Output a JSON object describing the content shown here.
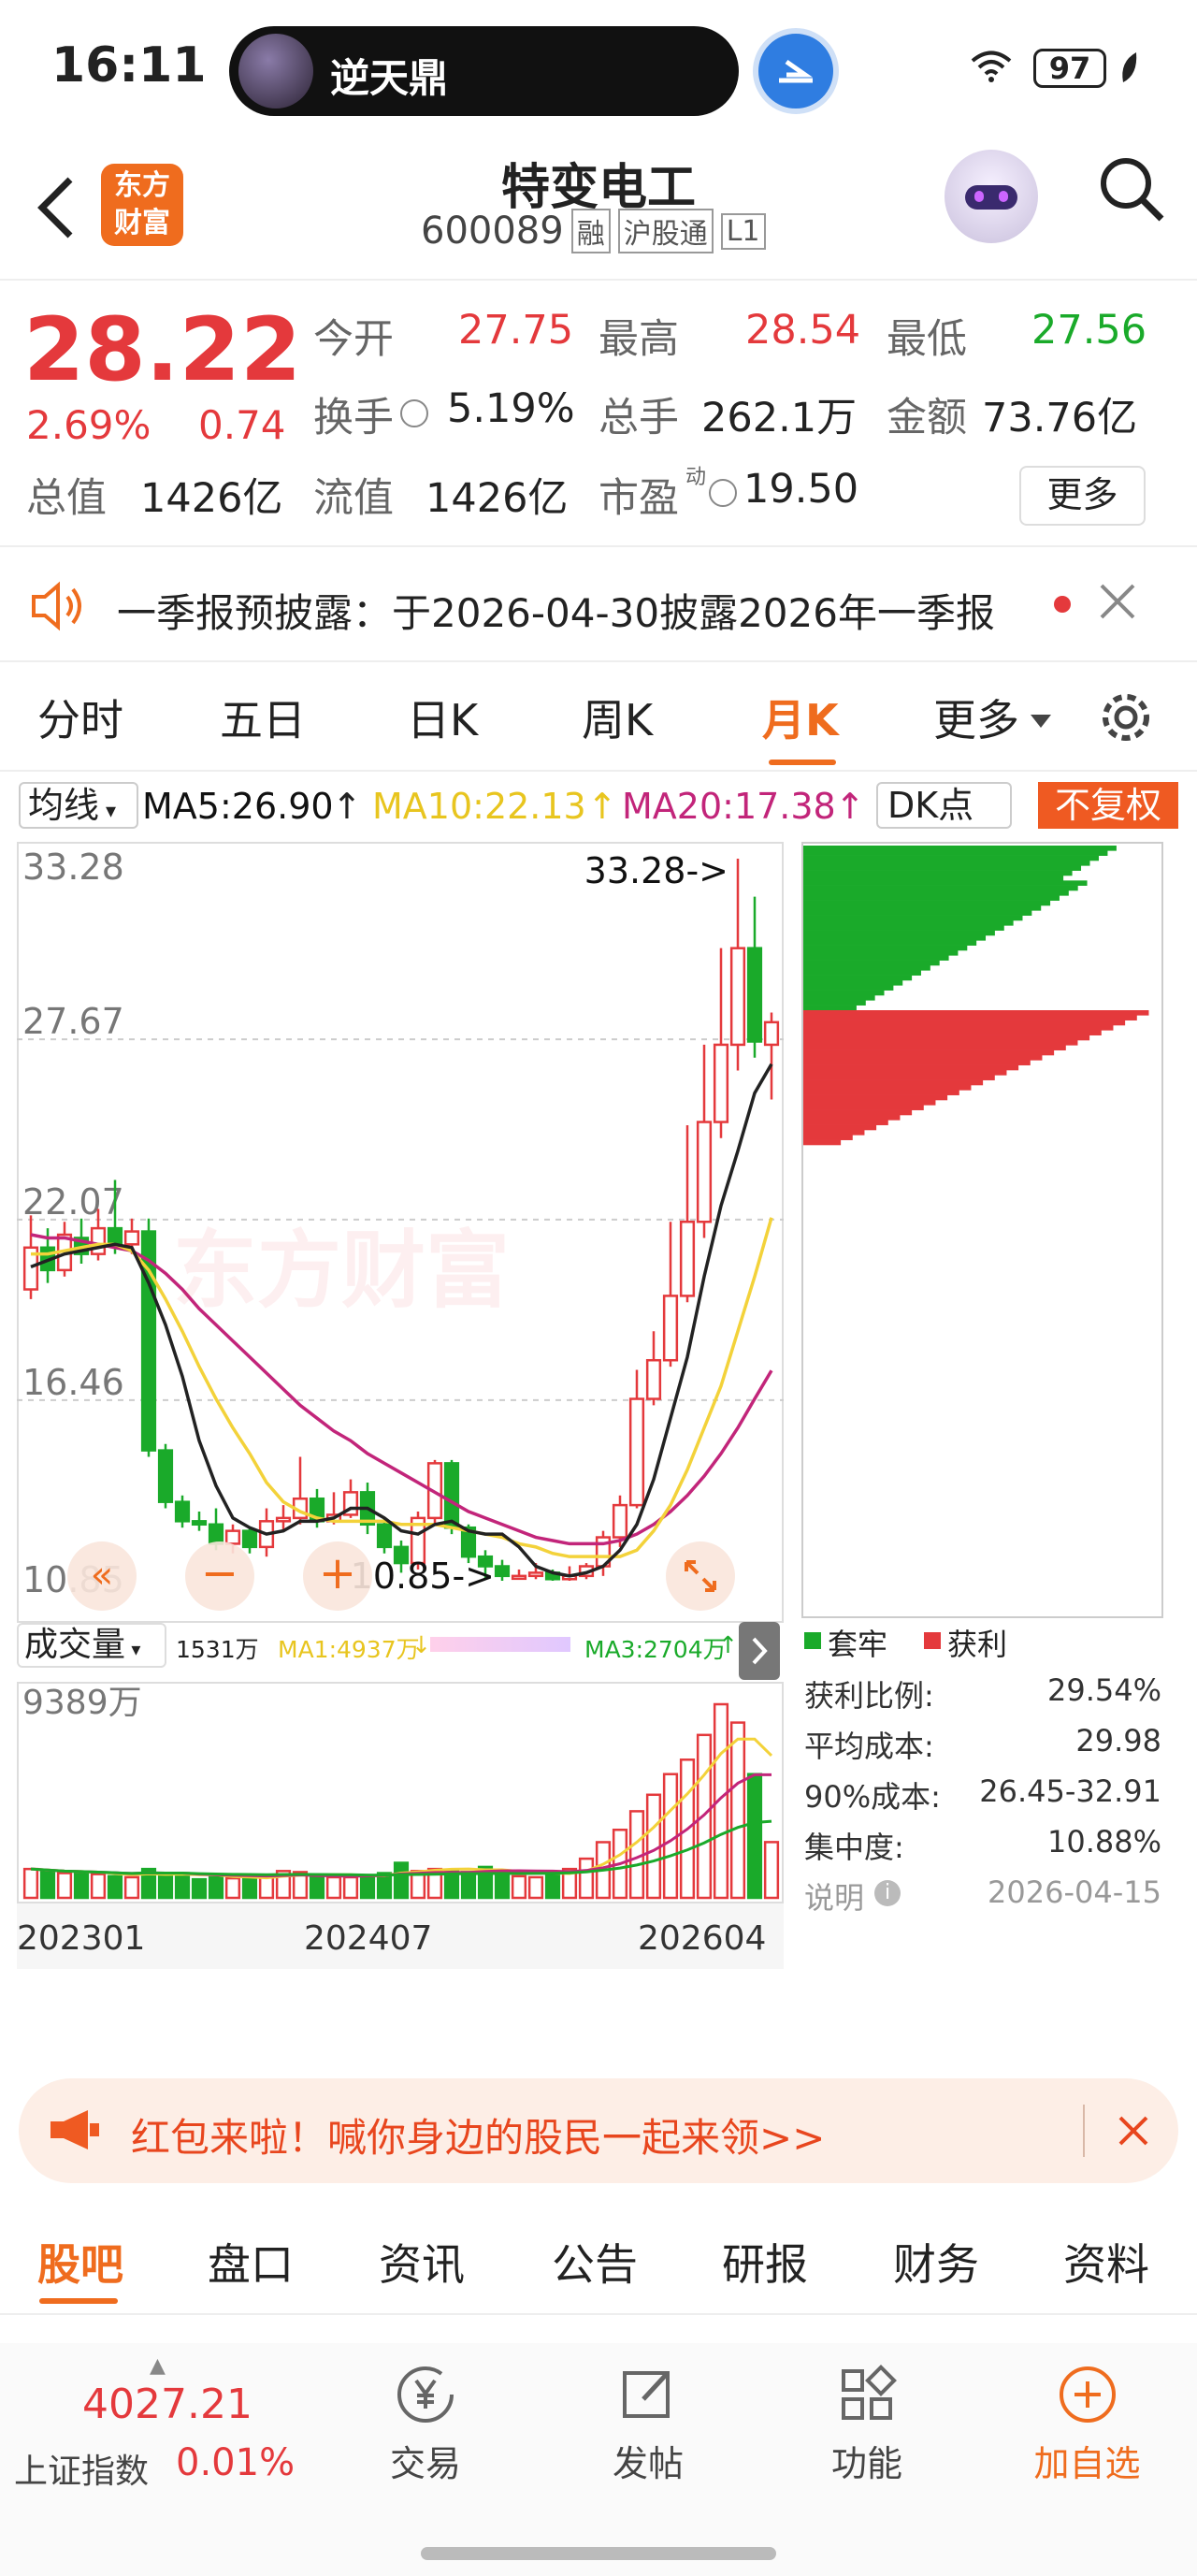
{
  "status_bar": {
    "time": "16:11",
    "pill_title": "逆天鼎",
    "battery": "97"
  },
  "header": {
    "title": "特变电工",
    "code": "600089",
    "tags": [
      "融",
      "沪股通",
      "L1"
    ],
    "logo_line1": "东方",
    "logo_line2": "财富"
  },
  "quote": {
    "price": "28.22",
    "change_pct": "2.69%",
    "change_amt": "0.74",
    "open_label": "今开",
    "open": "27.75",
    "high_label": "最高",
    "high": "28.54",
    "low_label": "最低",
    "low": "27.56",
    "turnover_label": "换手",
    "turnover": "5.19%",
    "volume_label": "总手",
    "volume": "262.1万",
    "amount_label": "金额",
    "amount": "73.76亿",
    "mktcap_label": "总值",
    "mktcap": "1426亿",
    "float_label": "流值",
    "float_cap": "1426亿",
    "pe_label": "市盈",
    "pe_sup": "动",
    "pe": "19.50",
    "more_label": "更多"
  },
  "notice": {
    "text": "一季报预披露：于2026-04-30披露2026年一季报"
  },
  "period_tabs": [
    "分时",
    "五日",
    "日K",
    "周K",
    "月K",
    "更多"
  ],
  "active_period": "月K",
  "ma_bar": {
    "selector": "均线",
    "ma5": "MA5:26.90",
    "ma10": "MA10:22.13",
    "ma20": "MA20:17.38",
    "dk": "DK点",
    "adjust": "不复权"
  },
  "chart_data": {
    "type": "candlestick",
    "y_ticks": [
      "33.28",
      "27.67",
      "22.07",
      "16.46",
      "10.85"
    ],
    "max_label": "33.28->",
    "min_label": "10.85->",
    "x_labels": [
      "202301",
      "202407",
      "202604"
    ],
    "watermark": "东方财富",
    "ylim": [
      10.85,
      33.28
    ],
    "candles": [
      [
        19.9,
        21.2,
        22.2,
        19.6
      ],
      [
        21.2,
        20.5,
        21.8,
        20.1
      ],
      [
        20.5,
        21.6,
        22.0,
        20.3
      ],
      [
        21.5,
        21.0,
        22.1,
        20.7
      ],
      [
        21.0,
        21.8,
        22.4,
        20.8
      ],
      [
        21.8,
        21.3,
        23.3,
        21.0
      ],
      [
        21.3,
        21.7,
        22.1,
        21.0
      ],
      [
        21.7,
        14.9,
        22.1,
        14.7
      ],
      [
        14.9,
        13.3,
        15.1,
        13.1
      ],
      [
        13.3,
        12.7,
        13.5,
        12.5
      ],
      [
        12.7,
        12.6,
        13.0,
        12.4
      ],
      [
        12.6,
        12.0,
        13.1,
        11.8
      ],
      [
        12.0,
        12.4,
        12.6,
        11.7
      ],
      [
        12.4,
        11.9,
        12.5,
        11.7
      ],
      [
        11.9,
        12.7,
        13.1,
        11.6
      ],
      [
        12.7,
        12.8,
        13.2,
        12.4
      ],
      [
        12.8,
        13.4,
        14.7,
        12.6
      ],
      [
        13.4,
        12.7,
        13.7,
        12.5
      ],
      [
        12.7,
        12.9,
        13.6,
        12.6
      ],
      [
        12.9,
        13.6,
        14.0,
        12.8
      ],
      [
        13.6,
        12.6,
        13.9,
        12.3
      ],
      [
        12.6,
        11.9,
        12.8,
        11.7
      ],
      [
        11.9,
        11.4,
        12.1,
        11.1
      ],
      [
        11.4,
        12.8,
        13.0,
        11.2
      ],
      [
        12.8,
        14.5,
        14.6,
        12.6
      ],
      [
        14.5,
        12.5,
        14.6,
        12.3
      ],
      [
        12.5,
        11.6,
        12.6,
        11.4
      ],
      [
        11.6,
        11.3,
        11.8,
        10.9
      ],
      [
        11.3,
        11.0,
        11.5,
        10.85
      ],
      [
        11.0,
        11.0,
        11.2,
        10.9
      ],
      [
        11.0,
        11.1,
        11.4,
        10.9
      ],
      [
        11.1,
        10.9,
        11.2,
        10.85
      ],
      [
        10.9,
        11.0,
        11.3,
        10.85
      ],
      [
        11.0,
        11.3,
        11.4,
        10.9
      ],
      [
        11.3,
        12.2,
        12.4,
        11.0
      ],
      [
        12.2,
        13.2,
        13.5,
        11.9
      ],
      [
        13.2,
        16.5,
        17.4,
        13.1
      ],
      [
        16.5,
        17.7,
        18.6,
        16.3
      ],
      [
        17.7,
        19.7,
        22.0,
        17.5
      ],
      [
        19.7,
        22.0,
        25.0,
        19.5
      ],
      [
        22.0,
        25.1,
        27.5,
        21.5
      ],
      [
        25.1,
        27.5,
        30.5,
        24.6
      ],
      [
        27.5,
        30.5,
        33.28,
        26.7
      ],
      [
        30.5,
        27.6,
        32.1,
        27.1
      ],
      [
        27.5,
        28.2,
        28.5,
        25.8
      ]
    ],
    "ma5": [
      20.6,
      20.8,
      21.0,
      21.1,
      21.2,
      21.3,
      21.2,
      20.1,
      18.8,
      17.2,
      15.2,
      13.8,
      12.8,
      12.5,
      12.3,
      12.4,
      12.7,
      12.7,
      12.8,
      13.1,
      13.1,
      12.8,
      12.4,
      12.3,
      12.6,
      12.7,
      12.4,
      12.3,
      12.3,
      11.9,
      11.3,
      11.1,
      11.0,
      11.1,
      11.3,
      11.8,
      12.6,
      14.0,
      15.9,
      17.8,
      20.3,
      22.5,
      24.2,
      26.0,
      26.9
    ],
    "ma10": [
      21.0,
      21.0,
      21.1,
      21.2,
      21.3,
      21.3,
      21.1,
      20.5,
      19.6,
      18.6,
      17.5,
      16.5,
      15.6,
      14.8,
      13.9,
      13.3,
      13.0,
      12.8,
      12.7,
      12.7,
      12.7,
      12.7,
      12.6,
      12.6,
      12.6,
      12.5,
      12.4,
      12.3,
      12.2,
      12.0,
      11.9,
      11.7,
      11.6,
      11.6,
      11.6,
      11.6,
      11.8,
      12.4,
      13.2,
      14.3,
      15.6,
      16.9,
      18.6,
      20.3,
      22.13
    ],
    "ma20": [
      21.6,
      21.5,
      21.5,
      21.4,
      21.3,
      21.2,
      21.1,
      20.8,
      20.4,
      19.9,
      19.3,
      18.8,
      18.3,
      17.8,
      17.3,
      16.8,
      16.3,
      15.9,
      15.5,
      15.2,
      14.8,
      14.5,
      14.2,
      13.9,
      13.6,
      13.3,
      13.0,
      12.8,
      12.6,
      12.4,
      12.2,
      12.1,
      12.0,
      12.0,
      12.0,
      12.1,
      12.3,
      12.6,
      13.0,
      13.5,
      14.1,
      14.8,
      15.6,
      16.5,
      17.38
    ],
    "volume": {
      "max_label": "9389万",
      "values": [
        1400,
        1300,
        1200,
        1200,
        1150,
        1050,
        1000,
        1400,
        1100,
        1200,
        900,
        1000,
        950,
        1000,
        1000,
        1300,
        1250,
        1050,
        1000,
        1000,
        1100,
        1200,
        1700,
        1300,
        1400,
        1350,
        1250,
        1500,
        1300,
        1050,
        1000,
        1150,
        1400,
        1900,
        2700,
        3300,
        4200,
        5000,
        6000,
        6700,
        7900,
        9389,
        8500,
        6000,
        2704
      ]
    },
    "vol_bar": {
      "title": "成交量",
      "v": "1531万",
      "ma1": "MA1:4937万",
      "ma3": "MA3:2704万"
    }
  },
  "cost_panel": {
    "legend_trap": "套牢",
    "legend_profit": "获利",
    "rows": [
      {
        "label": "获利比例:",
        "value": "29.54%"
      },
      {
        "label": "平均成本:",
        "value": "29.98"
      },
      {
        "label": "90%成本:",
        "value": "26.45-32.91"
      },
      {
        "label": "集中度:",
        "value": "10.88%"
      }
    ],
    "note_label": "说明",
    "note_date": "2026-04-15",
    "split_fraction": 0.22
  },
  "banner": {
    "text": "红包来啦！喊你身边的股民一起来领>>"
  },
  "bottom_tabs": [
    "股吧",
    "盘口",
    "资讯",
    "公告",
    "研报",
    "财务",
    "资料"
  ],
  "footer": {
    "index_value": "4027.21",
    "index_name": "上证指数",
    "index_change": "0.01%",
    "buttons": [
      {
        "label": "交易",
        "icon": "yen-icon"
      },
      {
        "label": "发帖",
        "icon": "edit-icon"
      },
      {
        "label": "功能",
        "icon": "grid-icon"
      },
      {
        "label": "加自选",
        "icon": "plus-circle-icon"
      }
    ]
  },
  "colors": {
    "up": "#e4393c",
    "down": "#1aaa2a",
    "ma5": "#222222",
    "ma10": "#f3d23a",
    "ma20": "#c2257a",
    "accent": "#ef6c1e"
  }
}
